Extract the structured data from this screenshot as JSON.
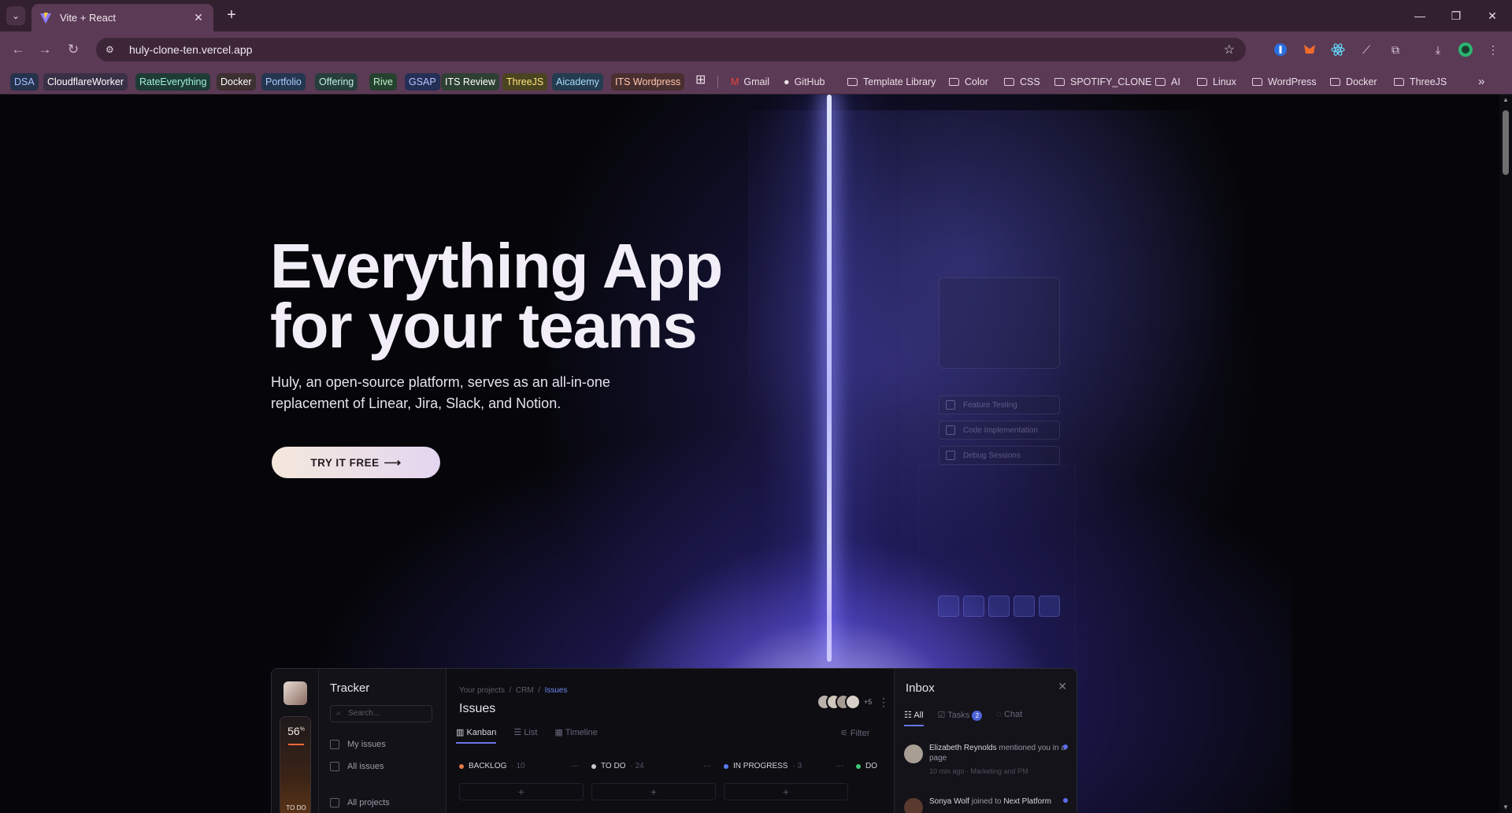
{
  "browser": {
    "tab_title": "Vite + React",
    "url": "huly-clone-ten.vercel.app",
    "colors": {
      "tabbar": "#33202f",
      "toolbar": "#5b3a55"
    },
    "bookmarks": [
      {
        "label": "DSA",
        "bg": "#27324d",
        "fg": "#9fc0ff"
      },
      {
        "label": "CloudflareWorker",
        "bg": "#3a3046",
        "fg": "#ffffff"
      },
      {
        "label": "RateEverything",
        "bg": "#1e3b36",
        "fg": "#9ef0d6"
      },
      {
        "label": "Docker",
        "bg": "#3c3030",
        "fg": "#ffffff"
      },
      {
        "label": "Portfolio",
        "bg": "#243650",
        "fg": "#a9ccff"
      },
      {
        "label": "Offering",
        "bg": "#263e3c",
        "fg": "#bfeee0"
      },
      {
        "label": "Rive",
        "bg": "#25422f",
        "fg": "#bff0c8"
      },
      {
        "label": "GSAP",
        "bg": "#252f55",
        "fg": "#b5c3ff"
      },
      {
        "label": "ITS Review",
        "bg": "#2e3f33",
        "fg": "#ffffff"
      },
      {
        "label": "ThreeJS",
        "bg": "#4a4420",
        "fg": "#ffe37a"
      },
      {
        "label": "Aicademy",
        "bg": "#243c4f",
        "fg": "#a8dcff"
      },
      {
        "label": "ITS Wordpress",
        "bg": "#4a2f30",
        "fg": "#ffc8b0"
      }
    ],
    "bookmark_links": [
      {
        "label": "Gmail",
        "icon": "gmail-icon"
      },
      {
        "label": "GitHub",
        "icon": "github-icon"
      }
    ],
    "bookmark_folders": [
      "Template Library",
      "Color",
      "CSS",
      "SPOTIFY_CLONE",
      "AI",
      "Linux",
      "WordPress",
      "Docker",
      "ThreeJS"
    ]
  },
  "hero": {
    "title_line1": "Everything App",
    "title_line2": "for your teams",
    "subtitle": "Huly, an open-source platform, serves as an all-in-one replacement of Linear, Jira, Slack, and Notion.",
    "cta": "TRY IT FREE"
  },
  "ghost": {
    "rows": [
      "Feature Testing",
      "Code Implementation",
      "Debug Sessions"
    ]
  },
  "app": {
    "progress_value": "56",
    "progress_unit": "%",
    "progress_label": "TO DO",
    "tracker_title": "Tracker",
    "search_placeholder": "Search...",
    "nav_items": [
      "My issues",
      "All issues",
      "All projects"
    ],
    "breadcrumbs": [
      "Your projects",
      "CRM",
      "Issues"
    ],
    "main_title": "Issues",
    "avatar_more": "+5",
    "views": [
      "Kanban",
      "List",
      "Timeline"
    ],
    "filter": "Filter",
    "columns": [
      {
        "name": "BACKLOG",
        "count": "10",
        "color": "#e2774a"
      },
      {
        "name": "TO DO",
        "count": "24",
        "color": "#c8c8d2"
      },
      {
        "name": "IN PROGRESS",
        "count": "3",
        "color": "#5a7cf0"
      },
      {
        "name": "DO",
        "count": "",
        "color": "#3ecb7a"
      }
    ],
    "inbox": {
      "title": "Inbox",
      "tabs": [
        "All",
        "Tasks",
        "Chat"
      ],
      "tasks_badge": "2",
      "messages": [
        {
          "name": "Elizabeth Reynolds",
          "text": "mentioned you in a page",
          "meta": "10 min ago · Marketing and PM"
        },
        {
          "name": "Sonya Wolf",
          "text": "joined to",
          "target": "Next Platform",
          "meta": ""
        }
      ]
    }
  }
}
